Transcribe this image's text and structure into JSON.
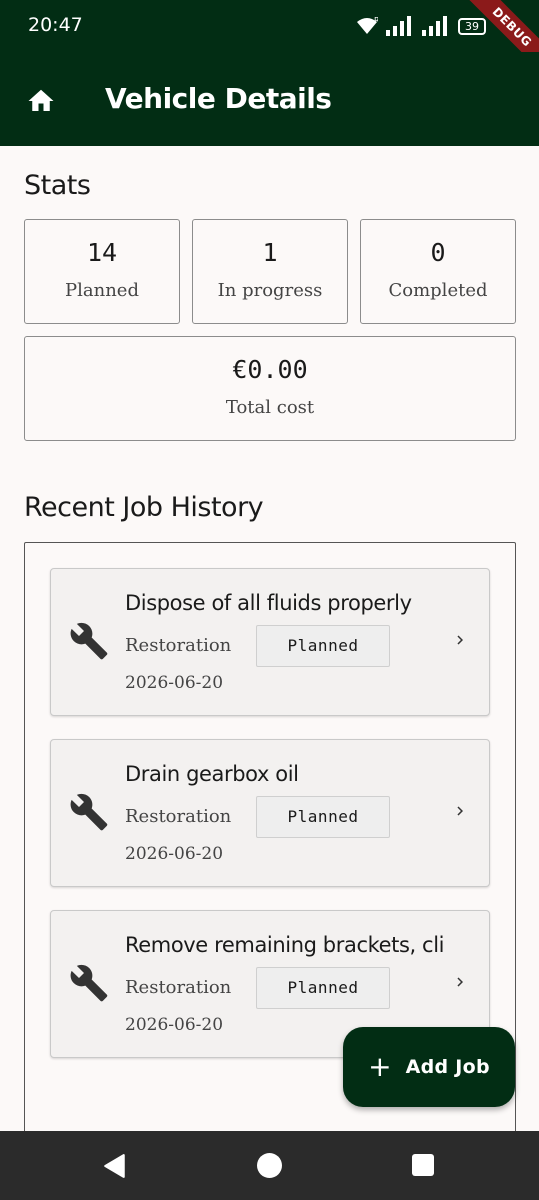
{
  "status_bar": {
    "time": "20:47",
    "battery": "39",
    "debug_label": "DEBUG"
  },
  "app_bar": {
    "title": "Vehicle Details",
    "home_icon": "home-icon"
  },
  "stats": {
    "title": "Stats",
    "planned": {
      "value": "14",
      "label": "Planned"
    },
    "in_progress": {
      "value": "1",
      "label": "In progress"
    },
    "completed": {
      "value": "0",
      "label": "Completed"
    },
    "total_cost": {
      "value": "€0.00",
      "label": "Total cost"
    }
  },
  "history": {
    "title": "Recent Job History",
    "jobs": [
      {
        "title": "Dispose of all fluids properly",
        "type": "Restoration",
        "status": "Planned",
        "date": "2026-06-20"
      },
      {
        "title": "Drain gearbox oil",
        "type": "Restoration",
        "status": "Planned",
        "date": "2026-06-20"
      },
      {
        "title": "Remove remaining brackets, cli...",
        "type": "Restoration",
        "status": "Planned",
        "date": "2026-06-20"
      }
    ]
  },
  "fab": {
    "icon": "+",
    "label": "Add Job"
  },
  "colors": {
    "primary": "#022d14",
    "background": "#fcf9f8",
    "card": "#f3f1f0"
  }
}
